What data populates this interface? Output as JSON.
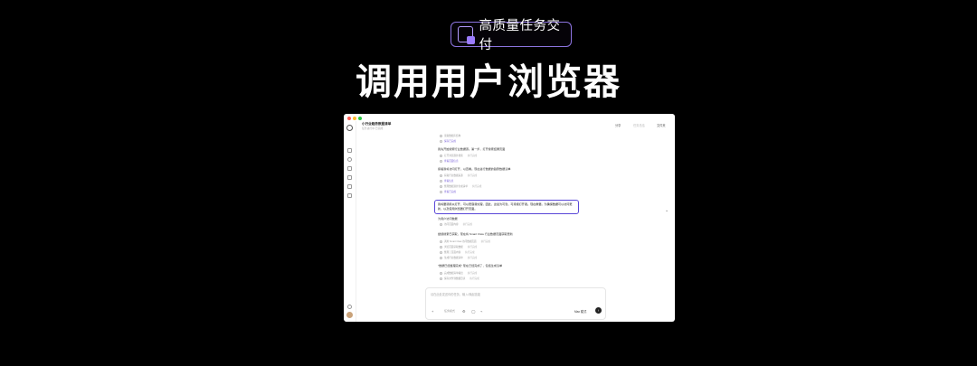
{
  "badge": {
    "icon": "task-delivery-icon",
    "text": "高质量任务交付"
  },
  "headline": "调用用户浏览器",
  "colors": {
    "accent": "#5a48d8",
    "badge_border": "#8d74e0",
    "background": "#000000"
  },
  "window": {
    "doc_title": "小行业趋势数据清单",
    "doc_subtitle": "任务进行中·已完成",
    "toolbar": {
      "share": "分享",
      "tasks": "任务总结",
      "files": "文件夹"
    },
    "chat": {
      "steps_top": [
        {
          "label": "读取数据库结构",
          "status": ""
        },
        {
          "label": "保存已完成",
          "status": ""
        }
      ],
      "para1": "我先开始搜索行业数据源。第一步，打开搜索结果页面",
      "steps_a": [
        {
          "label": "打开浏览器并搜索",
          "status": "执行完成"
        },
        {
          "label": "查看页面信息",
          "status": ""
        }
      ],
      "para2": "接着我将访问打开，以查看。现在进行数据的趋势数据清单",
      "steps_b": [
        {
          "label": "获取行业数据来源",
          "status": "执行完成"
        },
        {
          "label": "查看信息",
          "status": ""
        },
        {
          "label": "整理数据源并生成清单",
          "status": "执行完成"
        },
        {
          "label": "查看已完成",
          "status": ""
        }
      ],
      "highlight": "我将要调用以打开，可以更容易处理，因此，这最为可靠，可持续打开者。现在重要。为确保数据可以访问更新，以及使用浏览器打开页面。",
      "para3": "为用户访问数据",
      "steps_c": [
        {
          "label": "访问页面内容",
          "status": "执行完成"
        }
      ],
      "para4": "继续搜索已获取，现在将 Smart Claw 行业数据页面获取更新",
      "steps_d": [
        {
          "label": "调用 Smart Claw 访问数据页面",
          "status": "执行完成"
        },
        {
          "label": "浏览页面获取数据",
          "status": "执行完成"
        },
        {
          "label": "整理了页面内容",
          "status": "执行完成"
        },
        {
          "label": "生成行业数据清单",
          "status": "执行完成"
        }
      ],
      "para5": "\"数据已经整理完成\" 现在已经完成了，包括生成清单",
      "steps_e": [
        {
          "label": "完成数据清单输出",
          "status": "执行完成"
        },
        {
          "label": "保存文件到数据目录",
          "status": "执行完成"
        }
      ]
    },
    "input": {
      "placeholder": "请在此处发送你的任务，输入/唤起技能",
      "task_label": "任务模式",
      "model": "Max 模式",
      "send": "↑"
    }
  }
}
